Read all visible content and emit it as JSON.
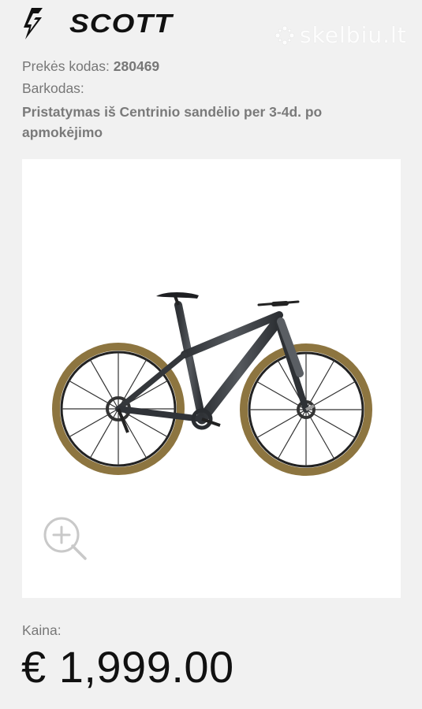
{
  "brand": {
    "name": "SCOTT"
  },
  "watermark": {
    "text": "skelbiu.lt"
  },
  "product": {
    "code_label": "Prekės kodas:",
    "code_value": "280469",
    "barcode_label": "Barkodas:",
    "delivery_text": "Pristatymas iš Centrinio sandėlio per 3-4d. po apmokėjimo",
    "price_label": "Kaina:",
    "price_value": "€ 1,999.00"
  },
  "media": {
    "image_subject": "mountain bike",
    "zoom_icon": "zoom-in-icon"
  },
  "colors": {
    "background": "#f1f1f1",
    "panel": "#ffffff",
    "text_dark": "#111111",
    "text_muted": "#777777",
    "tire": "#8d7540",
    "frame": "#3a3d41"
  }
}
